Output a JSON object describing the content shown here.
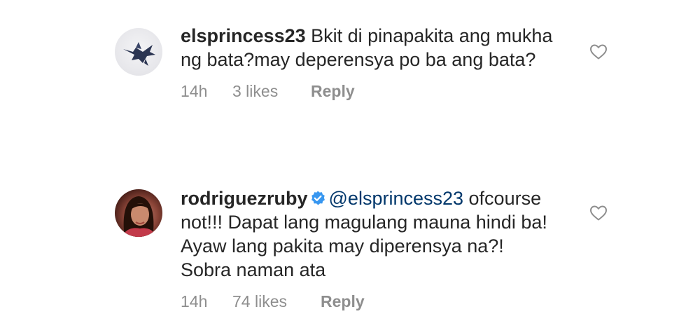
{
  "comments": [
    {
      "username": "elsprincess23",
      "verified": false,
      "mention": "",
      "text": "Bkit di pinapakita ang mukha ng bata?may deperensya po ba ang bata?",
      "time": "14h",
      "likes": "3 likes",
      "reply_label": "Reply",
      "avatar_icon": "bird-drawing-avatar",
      "like_icon": "heart-outline-icon"
    },
    {
      "username": "rodriguezruby",
      "verified": true,
      "verified_icon": "verified-badge-icon",
      "verified_color": "#3897f0",
      "mention": "@elsprincess23",
      "text": "ofcourse not!!! Dapat lang magulang mauna hindi ba! Ayaw lang pakita may diperensya na?! Sobra naman ata",
      "time": "14h",
      "likes": "74 likes",
      "reply_label": "Reply",
      "avatar_icon": "profile-photo-avatar",
      "like_icon": "heart-outline-icon"
    }
  ],
  "colors": {
    "text": "#262626",
    "meta": "#8e8e8e",
    "mention": "#00376b",
    "verified": "#3897f0"
  }
}
